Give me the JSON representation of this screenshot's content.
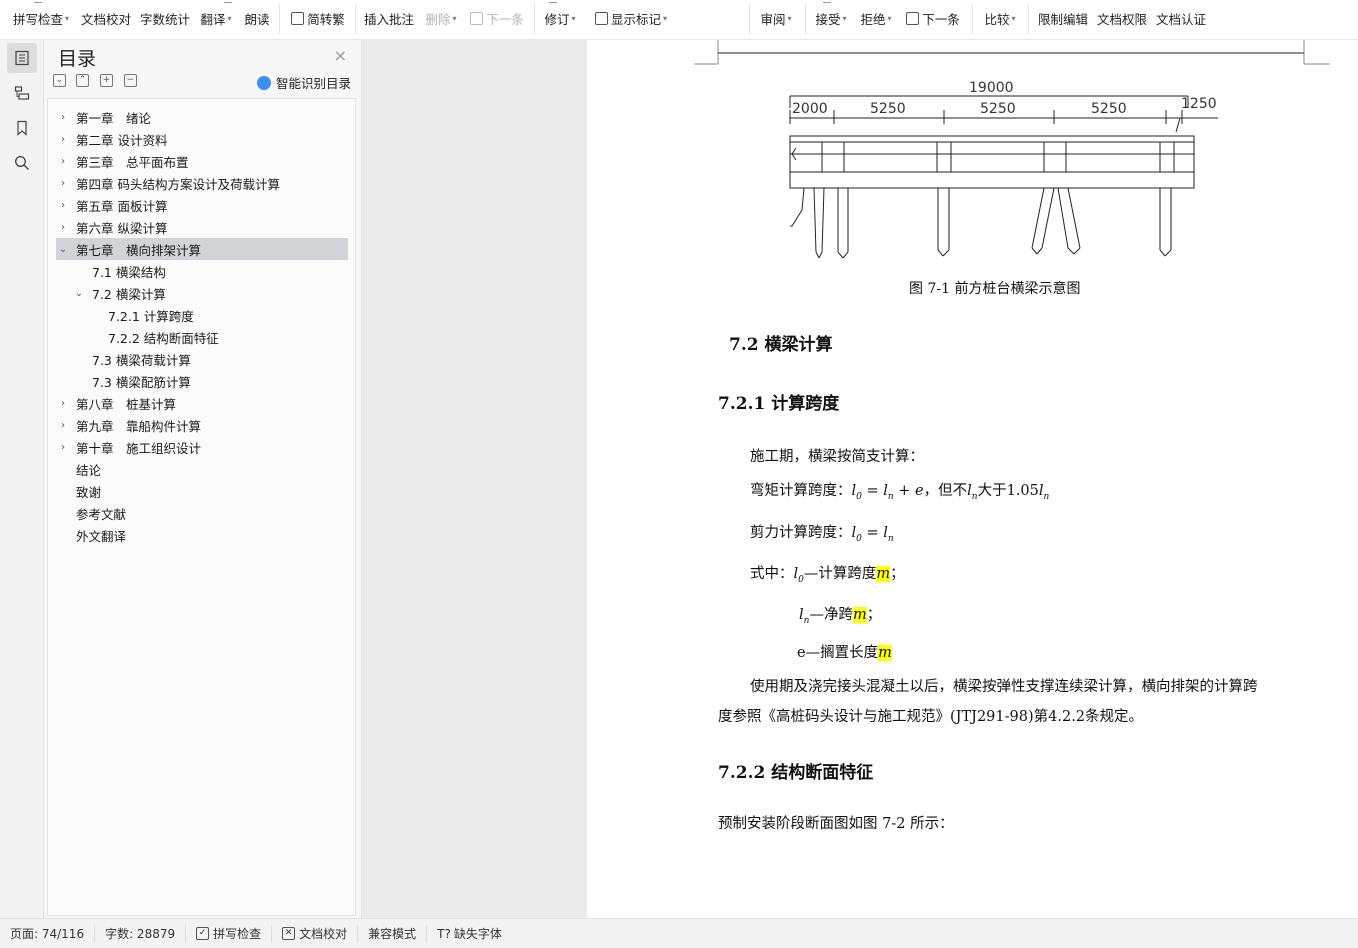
{
  "ribbon": {
    "spell_check": "拼写检查",
    "doc_proof": "文档校对",
    "word_count": "字数统计",
    "translate": "翻译",
    "read_aloud": "朗读",
    "simp_trad": "简转繁",
    "insert_comment": "插入批注",
    "delete": "删除",
    "next_comment": "下一条",
    "revise": "修订",
    "show_markup": "显示标记",
    "review": "审阅",
    "accept": "接受",
    "reject": "拒绝",
    "next_change": "下一条",
    "compare": "比较",
    "restrict_edit": "限制编辑",
    "doc_permission": "文档权限",
    "doc_cert": "文档认证"
  },
  "toc": {
    "title": "目录",
    "close": "×",
    "smart": "智能识别目录",
    "items": [
      {
        "label": "第一章　绪论",
        "level": 1,
        "arrow": "›"
      },
      {
        "label": "第二章  设计资料",
        "level": 1,
        "arrow": "›"
      },
      {
        "label": "第三章　总平面布置",
        "level": 1,
        "arrow": "›"
      },
      {
        "label": "第四章  码头结构方案设计及荷载计算",
        "level": 1,
        "arrow": "›"
      },
      {
        "label": "第五章  面板计算",
        "level": 1,
        "arrow": "›"
      },
      {
        "label": "第六章  纵梁计算",
        "level": 1,
        "arrow": "›"
      },
      {
        "label": "第七章　横向排架计算",
        "level": 1,
        "arrow": "⌄",
        "selected": true
      },
      {
        "label": "7.1 横梁结构",
        "level": 2,
        "arrow": ""
      },
      {
        "label": "7.2 横梁计算",
        "level": 2,
        "arrow": "⌄"
      },
      {
        "label": "7.2.1  计算跨度",
        "level": 3,
        "arrow": ""
      },
      {
        "label": "7.2.2  结构断面特征",
        "level": 3,
        "arrow": ""
      },
      {
        "label": "7.3 横梁荷载计算",
        "level": 2,
        "arrow": ""
      },
      {
        "label": "7.3 横梁配筋计算",
        "level": 2,
        "arrow": ""
      },
      {
        "label": "第八章　桩基计算",
        "level": 1,
        "arrow": "›"
      },
      {
        "label": "第九章　靠船构件计算",
        "level": 1,
        "arrow": "›"
      },
      {
        "label": "第十章　施工组织设计",
        "level": 1,
        "arrow": "›"
      },
      {
        "label": "结论",
        "level": 1,
        "arrow": ""
      },
      {
        "label": "致谢",
        "level": 1,
        "arrow": ""
      },
      {
        "label": "参考文献",
        "level": 1,
        "arrow": ""
      },
      {
        "label": "外文翻译",
        "level": 1,
        "arrow": ""
      }
    ]
  },
  "doc": {
    "dim_total": "19000",
    "dim_2000": "2000",
    "dim_5250a": "5250",
    "dim_5250b": "5250",
    "dim_5250c": "5250",
    "dim_1250": "1250",
    "fig_caption": "图 7-1  前方桩台横梁示意图",
    "h_72": "7.2 横梁计算",
    "h_721": "7.2.1  计算跨度",
    "p1": "施工期，横梁按简支计算：",
    "p2_label": "弯矩计算跨度：",
    "p2_mid": "，但不",
    "p2_tail": "大于1.05",
    "p3_label": "剪力计算跨度：",
    "p4_label": "式中：",
    "p4_desc": "—计算跨度",
    "p5_desc": "—净跨",
    "p6_desc": "e—搁置长度",
    "unit_m": "m",
    "p7_line1": "使用期及浇完接头混凝土以后，横梁按弹性支撑连续梁计算，横向排架的计算跨",
    "p7_line2": "度参照《高桩码头设计与施工规范》(JTJ291-98)第4.2.2条规定。",
    "h_722": "7.2.2  结构断面特征",
    "p8": "预制安装阶段断面图如图 7-2 所示："
  },
  "status": {
    "page": "页面: 74/116",
    "words": "字数: 28879",
    "spell": "拼写检查",
    "proof": "文档校对",
    "compat": "兼容模式",
    "missing_font": "缺失字体"
  }
}
